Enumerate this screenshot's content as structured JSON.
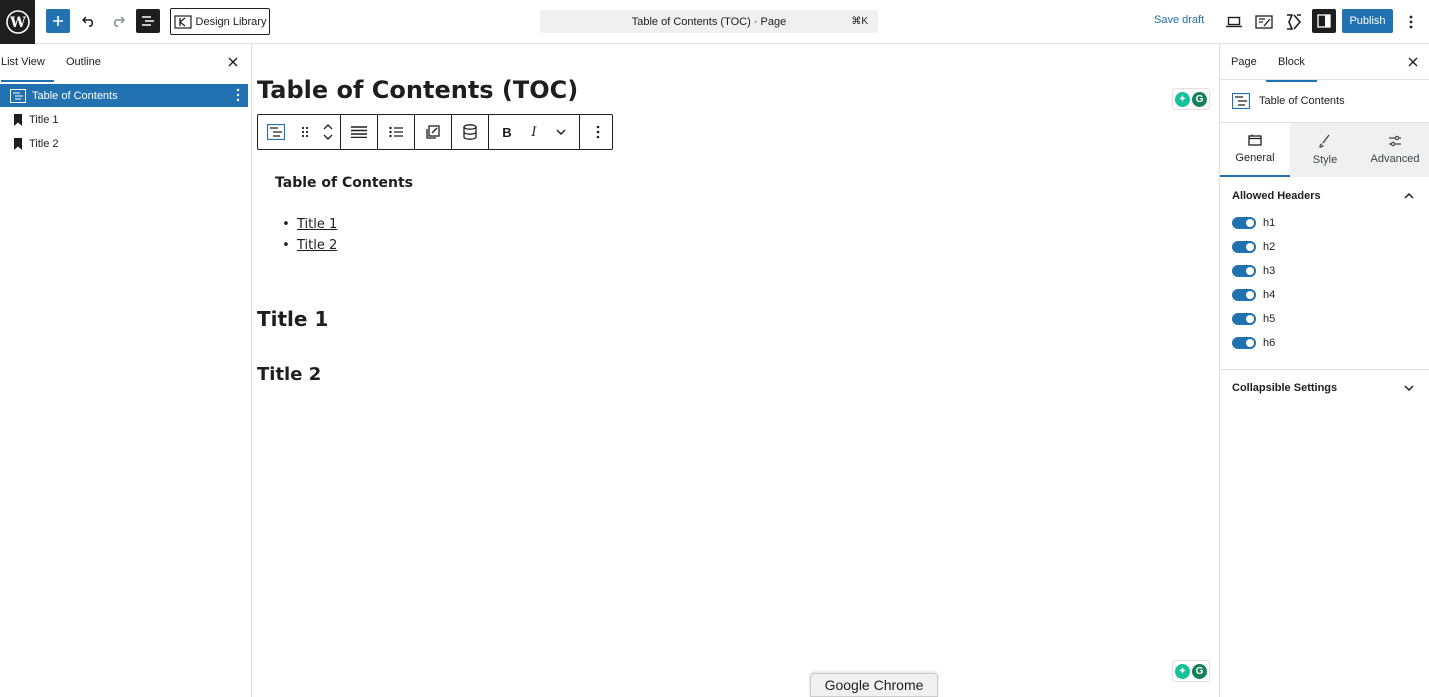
{
  "topbar": {
    "design_library_label": "Design Library",
    "document_title": "Table of Contents (TOC) · Page",
    "shortcut": "⌘K",
    "save_draft_label": "Save draft",
    "publish_label": "Publish"
  },
  "left_panel": {
    "tabs": [
      {
        "label": "List View"
      },
      {
        "label": "Outline"
      }
    ],
    "items": [
      {
        "label": "Table of Contents"
      },
      {
        "label": "Title 1"
      },
      {
        "label": "Title 2"
      }
    ]
  },
  "canvas": {
    "post_title": "Table of Contents (TOC)",
    "toc_heading": "Table of Contents",
    "toc_links": [
      {
        "label": "Title 1"
      },
      {
        "label": "Title 2"
      }
    ],
    "heading_1": "Title 1",
    "heading_2": "Title 2"
  },
  "right_panel": {
    "tabs": [
      {
        "label": "Page"
      },
      {
        "label": "Block"
      }
    ],
    "block_name": "Table of Contents",
    "subtabs": [
      {
        "label": "General"
      },
      {
        "label": "Style"
      },
      {
        "label": "Advanced"
      }
    ],
    "allowed_headers_title": "Allowed Headers",
    "headers": [
      {
        "label": "h1",
        "on": true
      },
      {
        "label": "h2",
        "on": true
      },
      {
        "label": "h3",
        "on": true
      },
      {
        "label": "h4",
        "on": true
      },
      {
        "label": "h5",
        "on": true
      },
      {
        "label": "h6",
        "on": true
      }
    ],
    "collapsible_title": "Collapsible Settings"
  },
  "tooltip": {
    "label": "Google Chrome"
  },
  "colors": {
    "accent": "#2271b1",
    "dark": "#1e1e1e",
    "grammarly_green": "#15c39a"
  }
}
